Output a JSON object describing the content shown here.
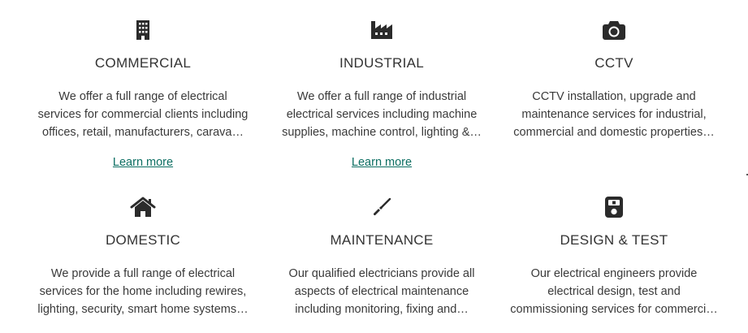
{
  "colors": {
    "text": "#333333",
    "link": "#0b6e62",
    "icon": "#2b2b2b",
    "background": "#ffffff"
  },
  "services": [
    {
      "icon": "building-icon",
      "title": "COMMERCIAL",
      "desc": [
        "We offer a full range of electrical",
        "services for commercial clients including",
        "offices, retail, manufacturers, carava…"
      ],
      "link": "Learn more"
    },
    {
      "icon": "factory-icon",
      "title": "INDUSTRIAL",
      "desc": [
        "We offer a full range of industrial",
        "electrical services including machine",
        "supplies, machine control, lighting &…"
      ],
      "link": "Learn more"
    },
    {
      "icon": "camera-icon",
      "title": "CCTV",
      "desc": [
        "CCTV installation, upgrade and",
        "maintenance services for industrial,",
        "commercial and domestic properties…"
      ]
    },
    {
      "icon": "home-icon",
      "title": "DOMESTIC",
      "desc": [
        "We provide a full range of electrical",
        "services for the home including rewires,",
        "lighting, security, smart home systems…"
      ]
    },
    {
      "icon": "screwdriver-icon",
      "title": "MAINTENANCE",
      "desc": [
        "Our qualified electricians provide all",
        "aspects of electrical maintenance",
        "including monitoring, fixing and…"
      ]
    },
    {
      "icon": "meter-icon",
      "title": "DESIGN & TEST",
      "desc": [
        "Our electrical engineers provide",
        "electrical design, test and",
        "commissioning services for commerci…"
      ]
    }
  ]
}
